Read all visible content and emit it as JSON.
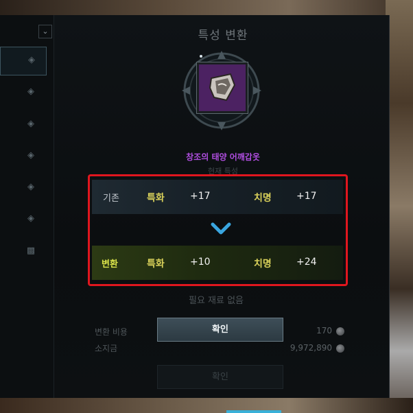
{
  "dialog": {
    "title": "특성 변환",
    "item_name": "창조의 태양 어깨갑옷",
    "item_icon": "shoulder-armor-icon",
    "item_icon_bg": "#4c2262",
    "current_label": "현재 특성",
    "base_row": {
      "label": "기존",
      "stat1_name": "특화",
      "stat1_value": "+17",
      "stat2_name": "치명",
      "stat2_value": "+17"
    },
    "changed_row": {
      "label": "변환",
      "stat1_name": "특화",
      "stat1_value": "+10",
      "stat2_name": "치명",
      "stat2_value": "+24"
    },
    "no_material_text": "필요 재료 없음",
    "cost_label": "변환 비용",
    "cost_value": "170",
    "gold_label": "소지금",
    "gold_value": "9,972,890",
    "confirm_label": "확인",
    "confirm_label_2": "확인",
    "highlight_color": "#e0161e",
    "arrow_color": "#3aa6e0"
  },
  "sidebar": {
    "items": [
      {
        "icon": "armor-slot-icon"
      },
      {
        "icon": "armor-slot-icon"
      },
      {
        "icon": "armor-slot-icon"
      },
      {
        "icon": "armor-slot-icon"
      },
      {
        "icon": "armor-slot-icon"
      },
      {
        "icon": "armor-slot-icon"
      },
      {
        "icon": "lock-icon"
      }
    ]
  }
}
